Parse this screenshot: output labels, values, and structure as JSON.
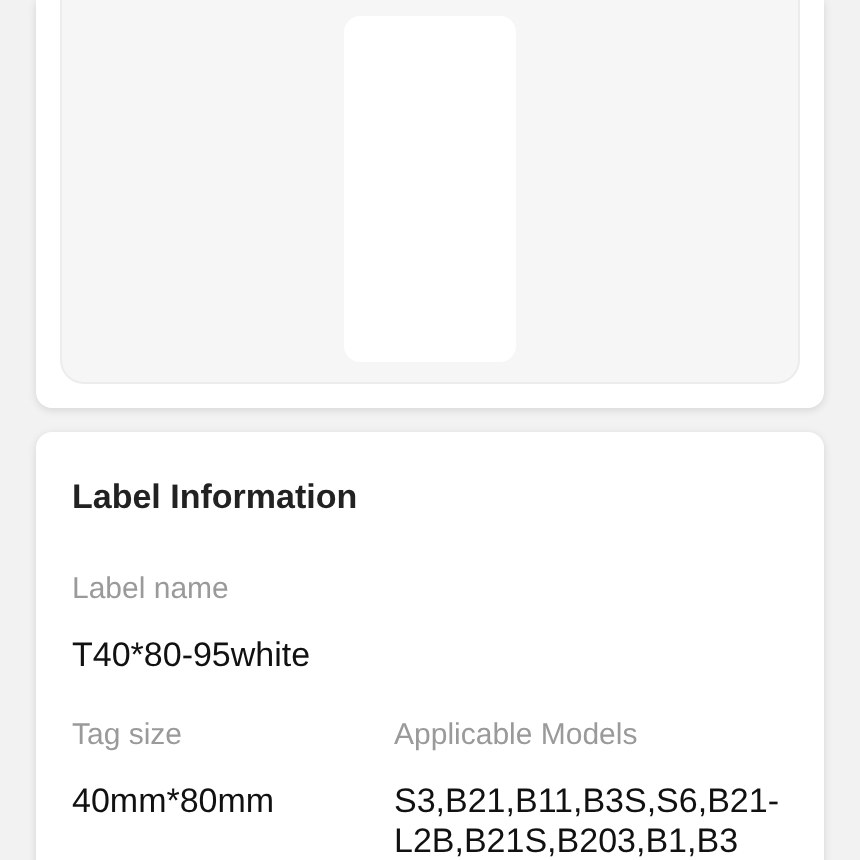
{
  "label_information": {
    "title": "Label Information",
    "fields": [
      {
        "label": "Label name",
        "value": "T40*80-95white"
      },
      {
        "label": "Tag size",
        "value": "40mm*80mm"
      },
      {
        "label": "Applicable Models",
        "value": "S3,B21,B11,B3S,S6,B21-L2B,B21S,B203,B1,B3"
      }
    ]
  }
}
